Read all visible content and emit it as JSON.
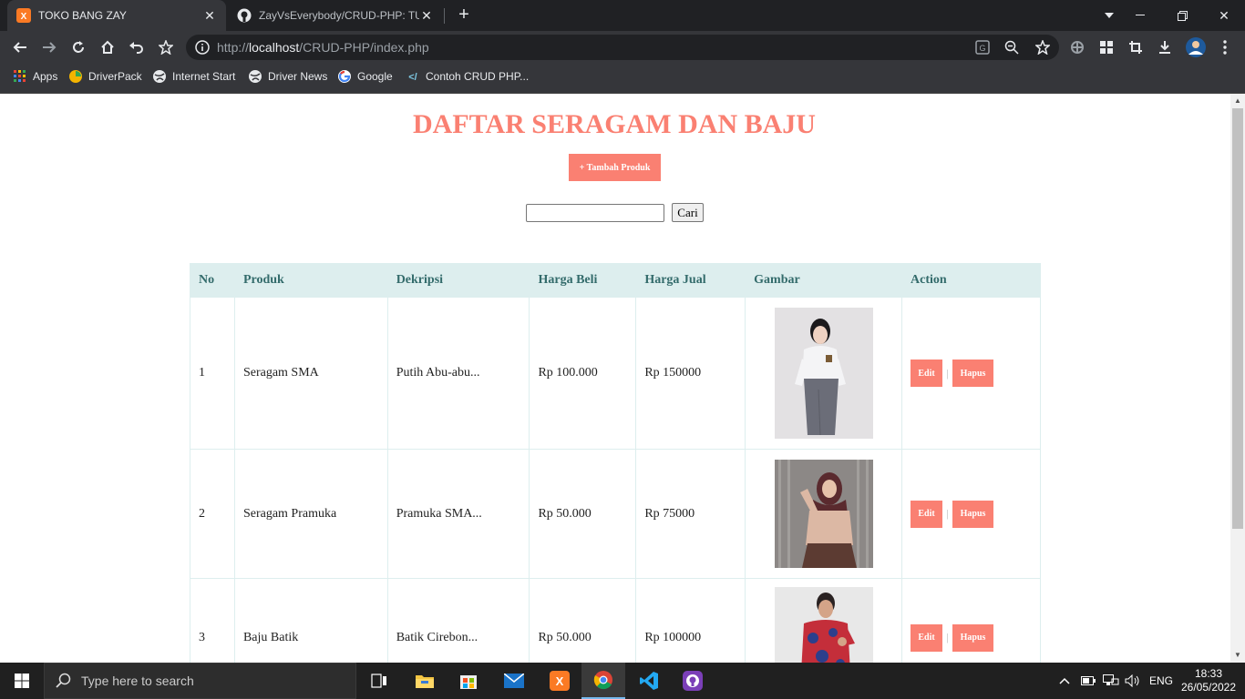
{
  "browser": {
    "tabs": [
      {
        "title": "TOKO BANG ZAY",
        "active": true
      },
      {
        "title": "ZayVsEverybody/CRUD-PHP: TUG",
        "active": false
      }
    ],
    "url_prefix": "http://",
    "url_host": "localhost",
    "url_path": "/CRUD-PHP/index.php",
    "bookmarks": [
      "Apps",
      "DriverPack",
      "Internet Start",
      "Driver News",
      "Google",
      "Contoh CRUD PHP..."
    ]
  },
  "page": {
    "title": "DAFTAR SERAGAM DAN BAJU",
    "add_button": "+ Tambah Produk",
    "search_button": "Cari",
    "search_value": ""
  },
  "table": {
    "headers": [
      "No",
      "Produk",
      "Dekripsi",
      "Harga Beli",
      "Harga Jual",
      "Gambar",
      "Action"
    ],
    "rows": [
      {
        "no": "1",
        "produk": "Seragam SMA",
        "deskripsi": "Putih Abu-abu...",
        "harga_beli": "Rp 100.000",
        "harga_jual": "Rp 150000",
        "image": "uniform-sma-photo"
      },
      {
        "no": "2",
        "produk": "Seragam Pramuka",
        "deskripsi": "Pramuka SMA...",
        "harga_beli": "Rp 50.000",
        "harga_jual": "Rp 75000",
        "image": "uniform-pramuka-photo"
      },
      {
        "no": "3",
        "produk": "Baju Batik",
        "deskripsi": "Batik Cirebon...",
        "harga_beli": "Rp 50.000",
        "harga_jual": "Rp 100000",
        "image": "batik-shirt-photo"
      }
    ],
    "edit_label": "Edit",
    "delete_label": "Hapus"
  },
  "taskbar": {
    "search_placeholder": "Type here to search",
    "language": "ENG",
    "time": "18:33",
    "date": "26/05/2022"
  },
  "colors": {
    "accent": "#fa8072",
    "header_bg": "#ddeeee",
    "header_text": "#336b6b"
  }
}
